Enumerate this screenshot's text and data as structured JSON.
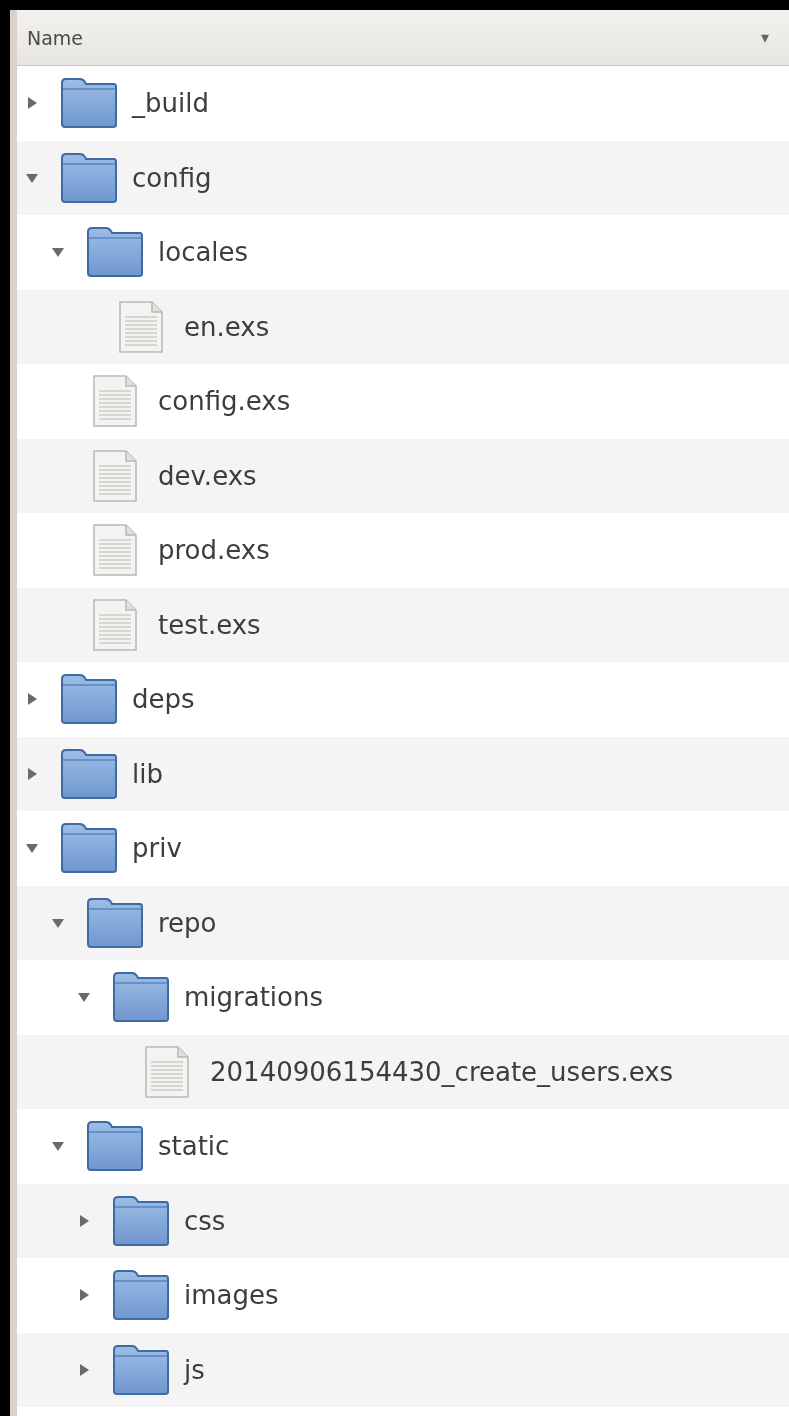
{
  "header": {
    "column": "Name",
    "sort_arrow": "▾"
  },
  "tree": [
    {
      "name": "_build",
      "kind": "folder",
      "expanded": false
    },
    {
      "name": "config",
      "kind": "folder",
      "expanded": true,
      "children": [
        {
          "name": "locales",
          "kind": "folder",
          "expanded": true,
          "children": [
            {
              "name": "en.exs",
              "kind": "file"
            }
          ]
        },
        {
          "name": "config.exs",
          "kind": "file"
        },
        {
          "name": "dev.exs",
          "kind": "file"
        },
        {
          "name": "prod.exs",
          "kind": "file"
        },
        {
          "name": "test.exs",
          "kind": "file"
        }
      ]
    },
    {
      "name": "deps",
      "kind": "folder",
      "expanded": false
    },
    {
      "name": "lib",
      "kind": "folder",
      "expanded": false
    },
    {
      "name": "priv",
      "kind": "folder",
      "expanded": true,
      "children": [
        {
          "name": "repo",
          "kind": "folder",
          "expanded": true,
          "children": [
            {
              "name": "migrations",
              "kind": "folder",
              "expanded": true,
              "children": [
                {
                  "name": "20140906154430_create_users.exs",
                  "kind": "file"
                }
              ]
            }
          ]
        },
        {
          "name": "static",
          "kind": "folder",
          "expanded": true,
          "children": [
            {
              "name": "css",
              "kind": "folder",
              "expanded": false
            },
            {
              "name": "images",
              "kind": "folder",
              "expanded": false
            },
            {
              "name": "js",
              "kind": "folder",
              "expanded": false
            }
          ]
        }
      ]
    }
  ]
}
